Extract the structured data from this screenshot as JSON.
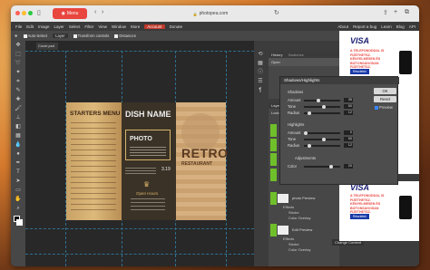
{
  "browser": {
    "tab_label": "Menu",
    "url": "photopea.com"
  },
  "menubar": {
    "items": [
      "File",
      "Edit",
      "Image",
      "Layer",
      "Select",
      "Filter",
      "View",
      "Window",
      "More"
    ],
    "account": "Account",
    "donate": "Donate",
    "right_items": [
      "About",
      "Report a bug",
      "Learn",
      "Blog",
      "API"
    ]
  },
  "options": {
    "auto_select": "Auto-Select",
    "layer_value": "Layer",
    "transform_controls": "Transform controls",
    "distances": "Distances"
  },
  "document": {
    "tab_label": "Cover.psd",
    "menu_left": {
      "heading": "STARTERS MENU"
    },
    "menu_mid": {
      "heading": "DISH NAME",
      "subheading": "PHOTO",
      "price": "3.19",
      "open_hours": "Open Hours"
    },
    "menu_right": {
      "heading": "RETRO",
      "subheading": "RESTAURANT"
    }
  },
  "history_panel": {
    "tabs": [
      "History",
      "Swatches"
    ],
    "items": [
      "Open"
    ]
  },
  "layers_panel": {
    "tabs": [
      "Layers",
      "Channels"
    ],
    "lock_label": "Lock:",
    "layers": [
      {
        "name": "photo Preview",
        "effects": "Effects",
        "fx1": "Stroke",
        "fx2": "Color Overlay"
      },
      {
        "name": "Edit Preview",
        "effects": "Effects",
        "fx1": "Stroke",
        "fx2": "Color Overlay"
      }
    ],
    "footer_button": "Change Content"
  },
  "dialog": {
    "title": "Shadows/Highlights",
    "shadows_label": "Shadows",
    "shadow_amount_label": "Amount",
    "shadow_amount": "35",
    "shadow_tone_label": "Tone",
    "shadow_tone": "50",
    "shadow_radius_label": "Radius",
    "shadow_radius": "12",
    "highlights_label": "Highlights",
    "hl_amount_label": "Amount",
    "hl_amount": "0",
    "hl_tone_label": "Tone",
    "hl_tone": "50",
    "hl_radius_label": "Radius",
    "hl_radius": "12",
    "adjustments_label": "Adjustments",
    "color_label": "Color",
    "color_value": "20",
    "ok": "OK",
    "reset": "Reset",
    "preview": "Preview"
  },
  "ads": [
    {
      "brand": "VISA",
      "text": "A TELEFONODDAL IS FIZETHETSZ. KÉNYELMESEN ÉS BIZTONSÁGOSAN FIZETHETSZ.",
      "button": "Részletek"
    },
    {
      "brand": "VISA",
      "text": "A TELEFONODDAL IS FIZETHETSZ. KÉNYELMESEN ÉS BIZTONSÁGOSAN FIZETHETSZ.",
      "button": "Részletek"
    }
  ],
  "colors": {
    "accent": "#e8463f",
    "visa_blue": "#1a1f71",
    "layer_eye": "#6fbf2a"
  }
}
